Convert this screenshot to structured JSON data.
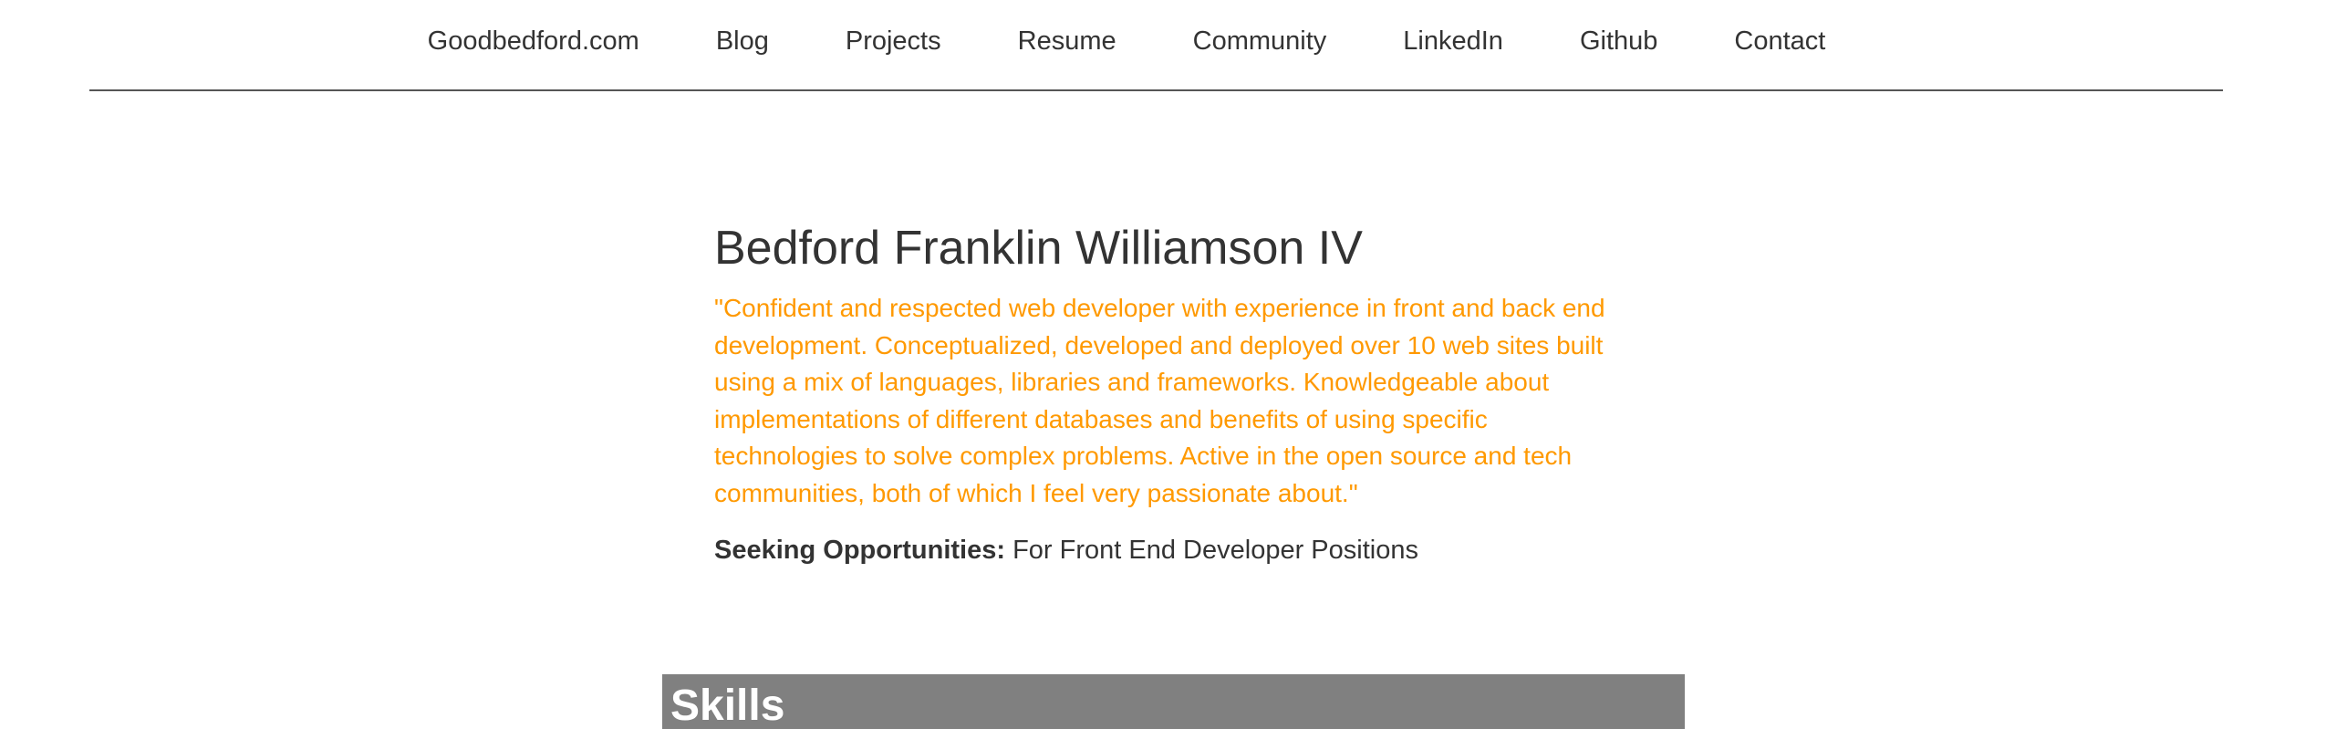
{
  "nav": {
    "items": [
      {
        "label": "Goodbedford.com"
      },
      {
        "label": "Blog"
      },
      {
        "label": "Projects"
      },
      {
        "label": "Resume"
      },
      {
        "label": "Community"
      },
      {
        "label": "LinkedIn"
      },
      {
        "label": "Github"
      },
      {
        "label": "Contact"
      }
    ]
  },
  "profile": {
    "name": "Bedford Franklin Williamson IV",
    "quote": "\"Confident and respected web developer with experience in front and back end development. Conceptualized, developed and deployed over 10 web sites built using a mix of languages, libraries and frameworks. Knowledgeable about implementations of different databases and benefits of using specific technologies to solve complex problems. Active in the open source and tech communities, both of which I feel very passionate about.\"",
    "seeking_label": "Seeking Opportunities:",
    "seeking_value": "For Front End Developer Positions"
  },
  "skills": {
    "title": "Skills"
  },
  "colors": {
    "quote": "#ff9900",
    "text": "#333333",
    "skills_panel": "#808080"
  }
}
